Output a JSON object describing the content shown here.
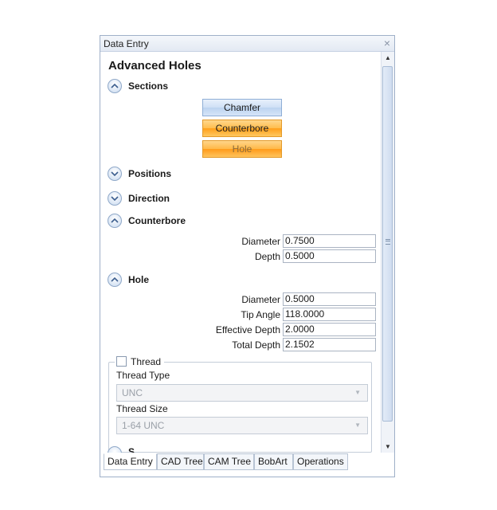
{
  "window": {
    "title": "Data Entry",
    "close_glyph": "×"
  },
  "panel": {
    "heading": "Advanced Holes",
    "sections": {
      "sections_label": "Sections",
      "positions_label": "Positions",
      "direction_label": "Direction",
      "counterbore_label": "Counterbore",
      "hole_label": "Hole"
    },
    "section_buttons": [
      "Chamfer",
      "Counterbore",
      "Hole"
    ],
    "counterbore": {
      "diameter_label": "Diameter",
      "diameter_value": "0.7500",
      "depth_label": "Depth",
      "depth_value": "0.5000"
    },
    "hole": {
      "diameter_label": "Diameter",
      "diameter_value": "0.5000",
      "tip_angle_label": "Tip Angle",
      "tip_angle_value": "118.0000",
      "effective_depth_label": "Effective Depth",
      "effective_depth_value": "2.0000",
      "total_depth_label": "Total Depth",
      "total_depth_value": "2.1502"
    },
    "thread": {
      "legend": "Thread",
      "checked": false,
      "type_label": "Thread Type",
      "type_value": "UNC",
      "size_label": "Thread Size",
      "size_value": "1-64 UNC"
    },
    "partial_next_section": "S"
  },
  "tabs": [
    "Data Entry",
    "CAD Tree",
    "CAM Tree",
    "BobArt",
    "Operations"
  ],
  "colors": {
    "accent_blue": "#cfe0f6",
    "accent_orange": "#ffb43a",
    "border": "#9fb0c8"
  }
}
